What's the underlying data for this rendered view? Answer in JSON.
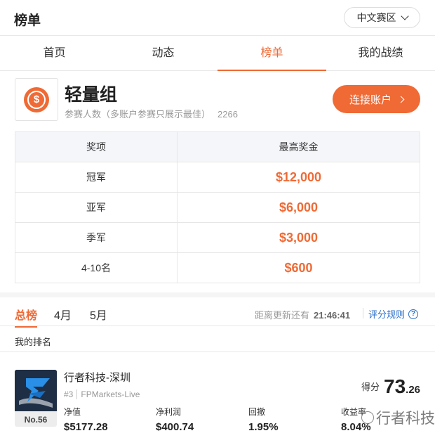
{
  "header": {
    "title": "榜单",
    "region": "中文赛区"
  },
  "tabs": [
    {
      "label": "首页"
    },
    {
      "label": "动态"
    },
    {
      "label": "榜单"
    },
    {
      "label": "我的战绩"
    }
  ],
  "group": {
    "icon_symbol": "$",
    "name": "轻量组",
    "participants_label": "参赛人数（多账户参赛只展示最佳）",
    "participants_count": "2266",
    "connect_label": "连接账户"
  },
  "prize_table": {
    "headers": [
      "奖项",
      "最高奖金"
    ],
    "rows": [
      {
        "rank": "冠军",
        "amount": "$12,000"
      },
      {
        "rank": "亚军",
        "amount": "$6,000"
      },
      {
        "rank": "季军",
        "amount": "$3,000"
      },
      {
        "rank": "4-10名",
        "amount": "$600"
      }
    ]
  },
  "period_tabs": [
    {
      "label": "总榜"
    },
    {
      "label": "4月"
    },
    {
      "label": "5月"
    }
  ],
  "update": {
    "label": "距离更新还有",
    "time": "21:46:41"
  },
  "rules_label": "评分规则",
  "my_rank_label": "我的排名",
  "my_entry": {
    "rank_badge": "No.56",
    "team_name": "行者科技-深圳",
    "account_no": "#3",
    "broker": "FPMarkets-Live",
    "score_label": "得分",
    "score_int": "73",
    "score_dec": ".26",
    "stats": [
      {
        "label": "净值",
        "value": "$5177.28"
      },
      {
        "label": "净利润",
        "value": "$400.74"
      },
      {
        "label": "回撤",
        "value": "1.95%"
      },
      {
        "label": "收益率",
        "value": "8.04%"
      }
    ]
  },
  "watermark": "行者科技",
  "colors": {
    "accent": "#ef6a35",
    "link": "#2a6fc9"
  }
}
